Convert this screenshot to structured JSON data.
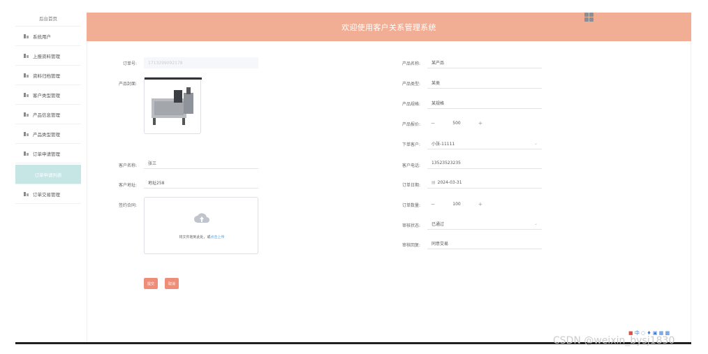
{
  "sidebar": {
    "home": "后台首页",
    "items": [
      {
        "label": "系统用户"
      },
      {
        "label": "上报资料管理"
      },
      {
        "label": "资料归档管理"
      },
      {
        "label": "客户类型管理"
      },
      {
        "label": "产品信息管理"
      },
      {
        "label": "产品类型管理"
      },
      {
        "label": "订单申请管理"
      },
      {
        "label": "订单申请列表"
      },
      {
        "label": "订单交易管理"
      }
    ]
  },
  "header": {
    "title": "欢迎使用客户关系管理系统"
  },
  "form": {
    "order_no": {
      "label": "订单号:",
      "value": "1713299092178"
    },
    "product_image": {
      "label": "产品封面:"
    },
    "customer_name": {
      "label": "客户名称:",
      "value": "张三"
    },
    "customer_address": {
      "label": "客户地址:",
      "value": "地址258"
    },
    "contract": {
      "label": "签约合同:",
      "hint_prefix": "将文件拖到此处，或",
      "hint_link": "点击上传"
    },
    "product_name": {
      "label": "产品名称:",
      "value": "某产品"
    },
    "product_type": {
      "label": "产品类型:",
      "value": "某类"
    },
    "product_spec": {
      "label": "产品规格:",
      "value": "某规格"
    },
    "product_price": {
      "label": "产品报价:",
      "value": "500",
      "minus": "−",
      "plus": "+"
    },
    "order_customer": {
      "label": "下单客户:",
      "value": "小张-11111"
    },
    "customer_phone": {
      "label": "客户电话:",
      "value": "13523523235"
    },
    "order_date": {
      "label": "订单日期:",
      "value": "2024-03-31"
    },
    "order_qty": {
      "label": "订单数量:",
      "value": "100",
      "minus": "−",
      "plus": "+"
    },
    "review_status": {
      "label": "审核状态:",
      "value": "已通过"
    },
    "review_reply": {
      "label": "审核回复:",
      "value": "同意交易"
    }
  },
  "actions": {
    "submit": "提交",
    "cancel": "取消"
  },
  "watermark": "CSDN @weixin_bysj1830",
  "colors": {
    "header": "#f2ae94",
    "active": "#c6e6e6",
    "button": "#ee8d78"
  }
}
